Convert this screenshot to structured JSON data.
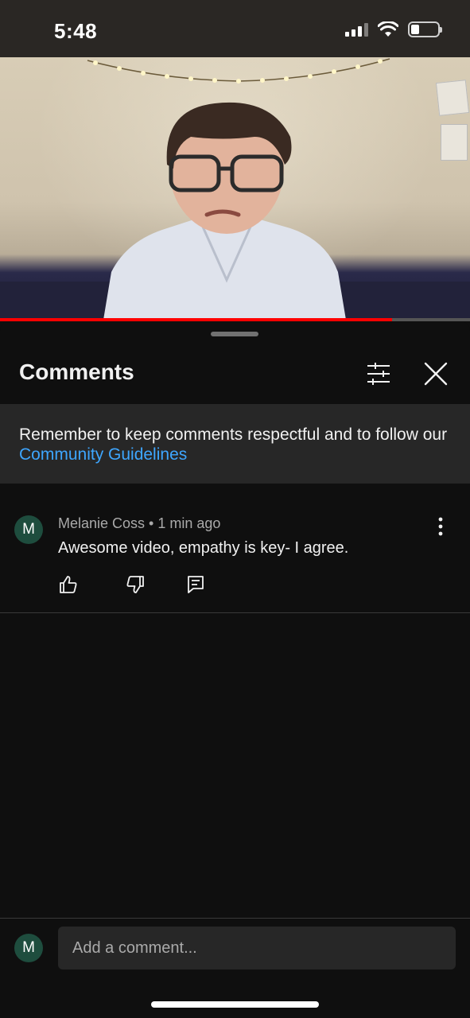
{
  "status_bar": {
    "time": "5:48",
    "battery_level": 0.3
  },
  "video": {
    "progress": 0.835,
    "progress_color": "#ff0000"
  },
  "comments_panel": {
    "title": "Comments",
    "notice_text": "Remember to keep comments respectful and to follow our ",
    "notice_link": "Community Guidelines",
    "link_color": "#3ea6ff",
    "comments": [
      {
        "avatar_letter": "M",
        "author": "Melanie Coss",
        "separator": " • ",
        "time": "1 min ago",
        "text": "Awesome video, empathy is key- I agree."
      }
    ]
  },
  "composer": {
    "avatar_letter": "M",
    "placeholder": "Add a comment..."
  },
  "icons": [
    "filter-icon",
    "close-icon",
    "more-vert-icon",
    "thumb-up-icon",
    "thumb-down-icon",
    "reply-icon"
  ],
  "colors": {
    "background": "#0f0f0f",
    "notice_background": "#272727",
    "avatar": "#1e4d3e"
  }
}
